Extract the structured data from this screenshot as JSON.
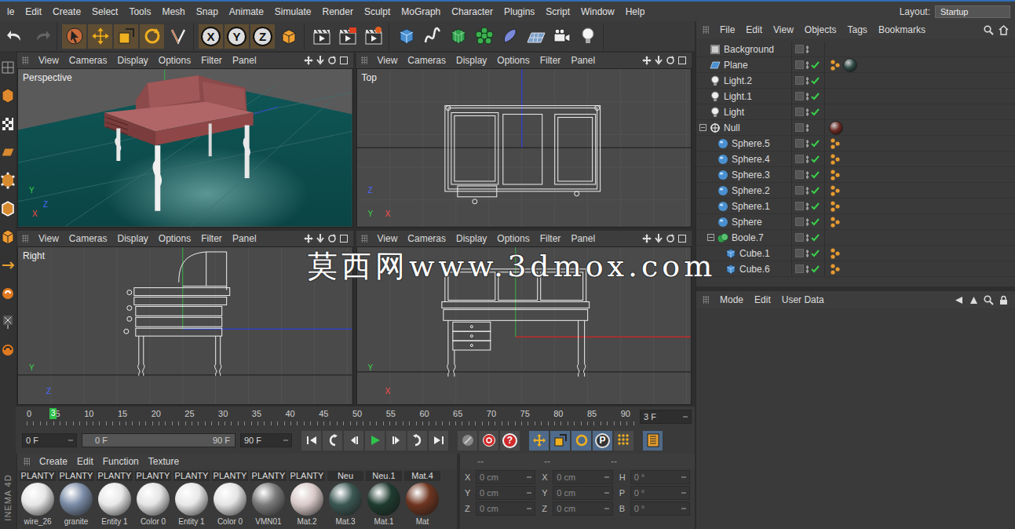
{
  "menu_bar": {
    "items": [
      "le",
      "Edit",
      "Create",
      "Select",
      "Tools",
      "Mesh",
      "Snap",
      "Animate",
      "Simulate",
      "Render",
      "Sculpt",
      "MoGraph",
      "Character",
      "Plugins",
      "Script",
      "Window",
      "Help"
    ],
    "layout_label": "Layout:",
    "layout_value": "Startup"
  },
  "toolbar": {
    "axes": [
      "X",
      "Y",
      "Z"
    ]
  },
  "viewports": [
    {
      "label": "Perspective",
      "menu": [
        "View",
        "Cameras",
        "Display",
        "Options",
        "Filter",
        "Panel"
      ],
      "gizmo": [
        "Y",
        "Z",
        "X"
      ]
    },
    {
      "label": "Top",
      "menu": [
        "View",
        "Cameras",
        "Display",
        "Options",
        "Filter",
        "Panel"
      ],
      "gizmo": [
        "Z",
        "Y",
        "X"
      ]
    },
    {
      "label": "Right",
      "menu": [
        "View",
        "Cameras",
        "Display",
        "Options",
        "Filter",
        "Panel"
      ],
      "gizmo": [
        "Y",
        "Z"
      ]
    },
    {
      "label": "",
      "menu": [
        "View",
        "Cameras",
        "Display",
        "Options",
        "Filter",
        "Panel"
      ],
      "gizmo": [
        "Y",
        "X"
      ]
    }
  ],
  "timeline": {
    "ticks": [
      "0",
      "5",
      "10",
      "15",
      "20",
      "25",
      "30",
      "35",
      "40",
      "45",
      "50",
      "55",
      "60",
      "65",
      "70",
      "75",
      "80",
      "85",
      "90"
    ],
    "current": "3",
    "level": 0.033,
    "frame_field": "3 F"
  },
  "playback": {
    "start": "0 F",
    "range_start": "0 F",
    "range_end": "90 F",
    "end": "90 F",
    "key_label": "P",
    "help": "?"
  },
  "materials": {
    "menu": [
      "Create",
      "Edit",
      "Function",
      "Texture"
    ],
    "items": [
      {
        "label": "PLANTY",
        "name": "wire_26",
        "color": "#e6e6e6"
      },
      {
        "label": "PLANTY",
        "name": "granite",
        "color": "#7a8ba6"
      },
      {
        "label": "PLANTY",
        "name": "Entity 1",
        "color": "#e8e8e8"
      },
      {
        "label": "PLANTY",
        "name": "Color 0",
        "color": "#e4e4e4"
      },
      {
        "label": "PLANTY",
        "name": "Entity 1",
        "color": "#e8e8e8"
      },
      {
        "label": "PLANTY",
        "name": "Color 0",
        "color": "#e4e4e4"
      },
      {
        "label": "PLANTY",
        "name": "VMN01",
        "color": "#7a7a7a"
      },
      {
        "label": "PLANTY",
        "name": "Mat.2",
        "color": "#d9c9c9"
      },
      {
        "label": "Neu",
        "name": "Mat.3",
        "color": "#3b5752"
      },
      {
        "label": "Neu.1",
        "name": "Mat.1",
        "color": "#1f3b30"
      },
      {
        "label": "Mat.4",
        "name": "Mat",
        "color": "#6e3520"
      }
    ]
  },
  "coordinates": {
    "headers": [
      "--",
      "--",
      "--"
    ],
    "rows": [
      {
        "axis": "X",
        "value": "0 cm",
        "size_axis": "X",
        "size": "0 cm",
        "rot_axis": "H",
        "rot": "0 °"
      },
      {
        "axis": "Y",
        "value": "0 cm",
        "size_axis": "Y",
        "size": "0 cm",
        "rot_axis": "P",
        "rot": "0 °"
      },
      {
        "axis": "Z",
        "value": "0 cm",
        "size_axis": "Z",
        "size": "0 cm",
        "rot_axis": "B",
        "rot": "0 °"
      }
    ]
  },
  "objects": {
    "menu": [
      "File",
      "Edit",
      "View",
      "Objects",
      "Tags",
      "Bookmarks"
    ],
    "items": [
      {
        "name": "Background",
        "depth": 0,
        "kind": "background",
        "expandable": false,
        "expanded": false,
        "checked": false,
        "tags": []
      },
      {
        "name": "Plane",
        "depth": 0,
        "kind": "plane",
        "expandable": false,
        "expanded": false,
        "checked": true,
        "tags": [
          {
            "kind": "phong"
          },
          {
            "kind": "material",
            "color": "#2f4a45"
          }
        ]
      },
      {
        "name": "Light.2",
        "depth": 0,
        "kind": "light",
        "expandable": false,
        "expanded": false,
        "checked": true,
        "tags": []
      },
      {
        "name": "Light.1",
        "depth": 0,
        "kind": "light",
        "expandable": false,
        "expanded": false,
        "checked": true,
        "tags": []
      },
      {
        "name": "Light",
        "depth": 0,
        "kind": "light",
        "expandable": false,
        "expanded": false,
        "checked": true,
        "tags": []
      },
      {
        "name": "Null",
        "depth": 0,
        "kind": "null",
        "expandable": true,
        "expanded": true,
        "checked": false,
        "tags": [
          {
            "kind": "material",
            "color": "#6e2a22"
          }
        ]
      },
      {
        "name": "Sphere.5",
        "depth": 1,
        "kind": "sphere",
        "expandable": false,
        "expanded": false,
        "checked": true,
        "tags": [
          {
            "kind": "phong"
          }
        ]
      },
      {
        "name": "Sphere.4",
        "depth": 1,
        "kind": "sphere",
        "expandable": false,
        "expanded": false,
        "checked": true,
        "tags": [
          {
            "kind": "phong"
          }
        ]
      },
      {
        "name": "Sphere.3",
        "depth": 1,
        "kind": "sphere",
        "expandable": false,
        "expanded": false,
        "checked": true,
        "tags": [
          {
            "kind": "phong"
          }
        ]
      },
      {
        "name": "Sphere.2",
        "depth": 1,
        "kind": "sphere",
        "expandable": false,
        "expanded": false,
        "checked": true,
        "tags": [
          {
            "kind": "phong"
          }
        ]
      },
      {
        "name": "Sphere.1",
        "depth": 1,
        "kind": "sphere",
        "expandable": false,
        "expanded": false,
        "checked": true,
        "tags": [
          {
            "kind": "phong"
          }
        ]
      },
      {
        "name": "Sphere",
        "depth": 1,
        "kind": "sphere",
        "expandable": false,
        "expanded": false,
        "checked": true,
        "tags": [
          {
            "kind": "phong"
          }
        ]
      },
      {
        "name": "Boole.7",
        "depth": 1,
        "kind": "boole",
        "expandable": true,
        "expanded": true,
        "checked": true,
        "tags": []
      },
      {
        "name": "Cube.1",
        "depth": 2,
        "kind": "cube",
        "expandable": false,
        "expanded": false,
        "checked": true,
        "tags": [
          {
            "kind": "phong"
          }
        ]
      },
      {
        "name": "Cube.6",
        "depth": 2,
        "kind": "cube",
        "expandable": false,
        "expanded": false,
        "checked": true,
        "tags": [
          {
            "kind": "phong"
          }
        ]
      }
    ]
  },
  "attributes": {
    "menu": [
      "Mode",
      "Edit",
      "User Data"
    ]
  },
  "brand": "INEMA 4D",
  "watermark": "莫西网www.3dmox.com"
}
